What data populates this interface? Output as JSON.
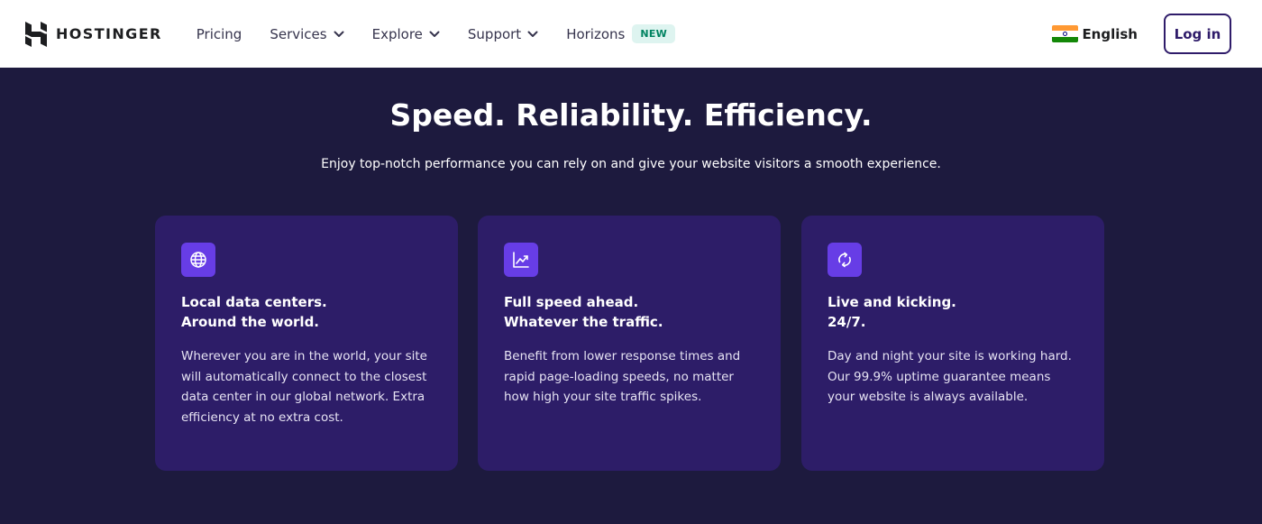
{
  "header": {
    "brand": "HOSTINGER",
    "nav": [
      {
        "label": "Pricing",
        "has_dropdown": false
      },
      {
        "label": "Services",
        "has_dropdown": true
      },
      {
        "label": "Explore",
        "has_dropdown": true
      },
      {
        "label": "Support",
        "has_dropdown": true
      },
      {
        "label": "Horizons",
        "has_dropdown": false,
        "badge": "NEW"
      }
    ],
    "language": {
      "label": "English",
      "flag_icon": "india-flag-icon"
    },
    "login_label": "Log in"
  },
  "hero": {
    "title": "Speed. Reliability. Efficiency.",
    "subtitle": "Enjoy top-notch performance you can rely on and give your website visitors a smooth experience."
  },
  "cards": [
    {
      "icon": "globe-icon",
      "title_line1": "Local data centers.",
      "title_line2": "Around the world.",
      "text": "Wherever you are in the world, your site will automatically connect to the closest data center in our global network. Extra efficiency at no extra cost."
    },
    {
      "icon": "trend-chart-icon",
      "title_line1": "Full speed ahead.",
      "title_line2": "Whatever the traffic.",
      "text": "Benefit from lower response times and rapid page-loading speeds, no matter how high your site traffic spikes."
    },
    {
      "icon": "refresh-icon",
      "title_line1": "Live and kicking.",
      "title_line2": "24/7.",
      "text": "Day and night your site is working hard. Our 99.9% uptime guarantee means your website is always available."
    }
  ],
  "colors": {
    "page_bg": "#1d1a3e",
    "card_bg": "#2d1d68",
    "accent": "#673de6",
    "brand_dark": "#2f1c6a",
    "badge_bg": "#def4f0",
    "badge_text": "#008361"
  }
}
